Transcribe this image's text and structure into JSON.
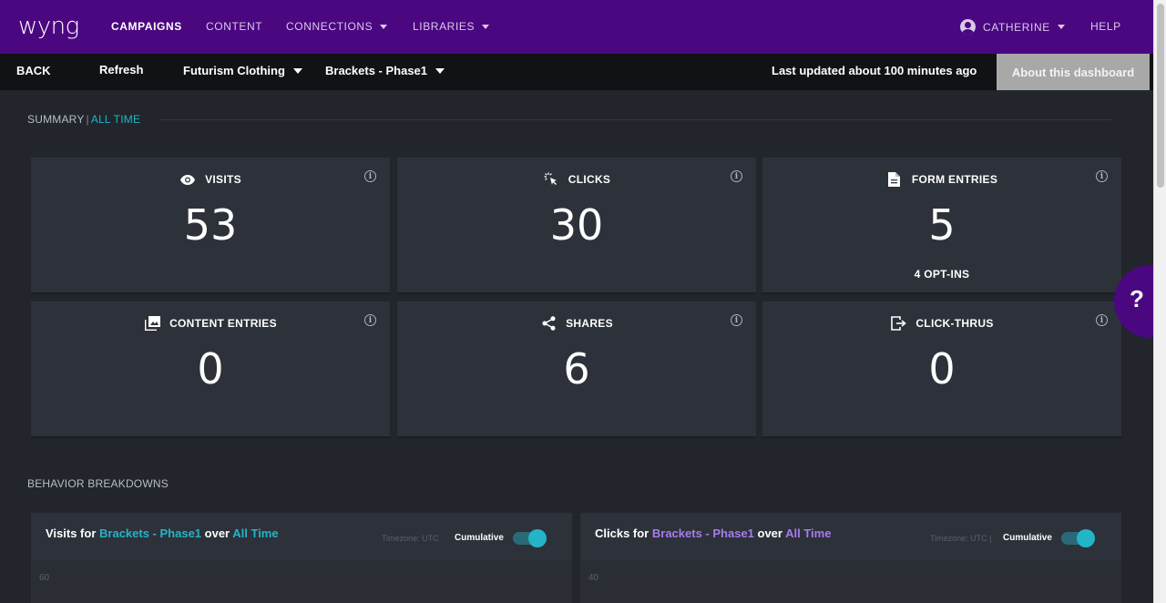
{
  "nav": {
    "logo": "wyng",
    "items": [
      {
        "label": "CAMPAIGNS"
      },
      {
        "label": "CONTENT"
      },
      {
        "label": "CONNECTIONS"
      },
      {
        "label": "LIBRARIES"
      }
    ],
    "user": "CATHERINE",
    "help": "HELP"
  },
  "subbar": {
    "back": "BACK",
    "refresh": "Refresh",
    "account": "Futurism Clothing",
    "campaign": "Brackets - Phase1",
    "last_updated": "Last updated about 100 minutes ago",
    "about": "About this dashboard"
  },
  "summary": {
    "label": "SUMMARY",
    "range": "ALL TIME"
  },
  "cards": [
    {
      "icon": "eye-icon",
      "label": "VISITS",
      "value": "53"
    },
    {
      "icon": "cursor-click-icon",
      "label": "CLICKS",
      "value": "30"
    },
    {
      "icon": "document-icon",
      "label": "FORM ENTRIES",
      "value": "5",
      "sub": "4 OPT-INS"
    },
    {
      "icon": "image-gallery-icon",
      "label": "CONTENT ENTRIES",
      "value": "0"
    },
    {
      "icon": "share-icon",
      "label": "SHARES",
      "value": "6"
    },
    {
      "icon": "exit-icon",
      "label": "CLICK-THRUS",
      "value": "0"
    }
  ],
  "help_bubble": "?",
  "behavior": {
    "label": "BEHAVIOR BREAKDOWNS"
  },
  "charts": [
    {
      "title_prefix": "Visits for",
      "campaign": "Brackets - Phase1",
      "over": "over",
      "range": "All Time",
      "timezone": "Timezone: UTC",
      "cumulative": "Cumulative",
      "y_tick": "60"
    },
    {
      "title_prefix": "Clicks for",
      "campaign": "Brackets - Phase1",
      "over": "over",
      "range": "All Time",
      "timezone": "Timezone: UTC |",
      "cumulative": "Cumulative",
      "y_tick": "40"
    }
  ],
  "colors": {
    "brand": "#4b0780",
    "accent_cyan": "#24b4c8",
    "accent_purple": "#a77bf0"
  }
}
